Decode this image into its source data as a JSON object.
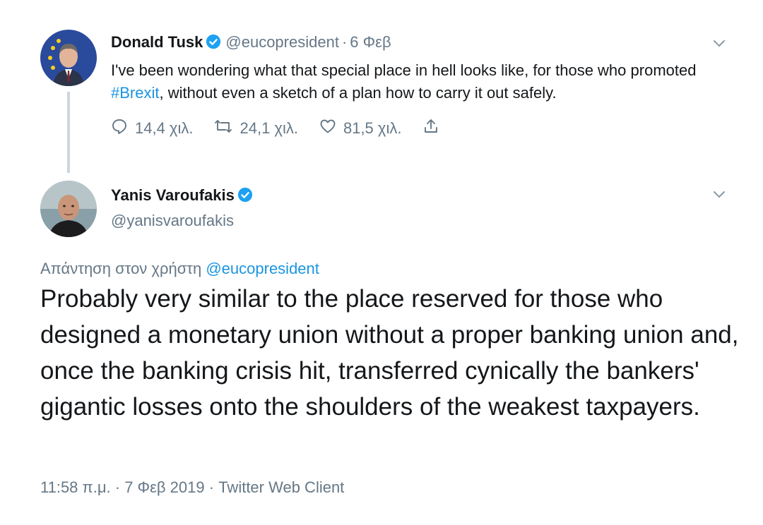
{
  "tweet1": {
    "name": "Donald Tusk",
    "handle": "@eucopresident",
    "separator": "·",
    "date": "6 Φεβ",
    "text_before": "I've been wondering what that special place in hell looks like, for those who promoted ",
    "hashtag": "#Brexit",
    "text_after": ", without even a sketch of a plan how to carry it out safely.",
    "replies": "14,4 χιλ.",
    "retweets": "24,1 χιλ.",
    "likes": "81,5 χιλ."
  },
  "tweet2": {
    "name": "Yanis Varoufakis",
    "handle": "@yanisvaroufakis",
    "replying_label": "Απάντηση στον χρήστη",
    "replying_to": "@eucopresident",
    "text": "Probably very similar to the place reserved for those who designed a monetary union without a proper banking union and, once the banking crisis hit, transferred cynically the bankers' gigantic losses onto the shoulders of the weakest taxpayers.",
    "time": "11:58 π.μ.",
    "date": "7 Φεβ 2019",
    "source": "Twitter Web Client",
    "separator": "·"
  },
  "colors": {
    "link": "#1b95e0",
    "muted": "#657786",
    "text": "#14171a",
    "verified": "#1da1f2",
    "thread_line": "#ccd6dd"
  },
  "icons": [
    "reply-icon",
    "retweet-icon",
    "like-icon",
    "share-icon",
    "verified-badge-icon",
    "chevron-down-icon"
  ]
}
